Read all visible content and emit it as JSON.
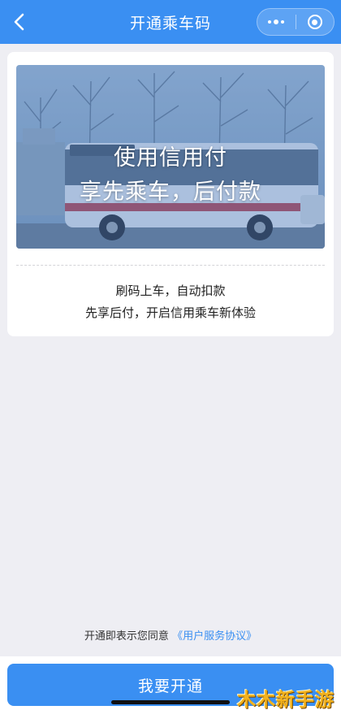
{
  "navbar": {
    "title": "开通乘车码",
    "back_icon": "chevron-left-icon",
    "more_icon": "more-dots-icon",
    "close_icon": "target-circle-icon",
    "bg_color": "#3a8ff2"
  },
  "banner": {
    "line1": "使用信用付",
    "line2": "享先乘车，后付款"
  },
  "description": {
    "line1": "刷码上车，自动扣款",
    "line2": "先享后付，开启信用乘车新体验"
  },
  "agreement": {
    "prefix": "开通即表示您同意",
    "link": "《用户服务协议》"
  },
  "primary_button": {
    "label": "我要开通"
  },
  "watermark": {
    "text": "木木新手游"
  }
}
